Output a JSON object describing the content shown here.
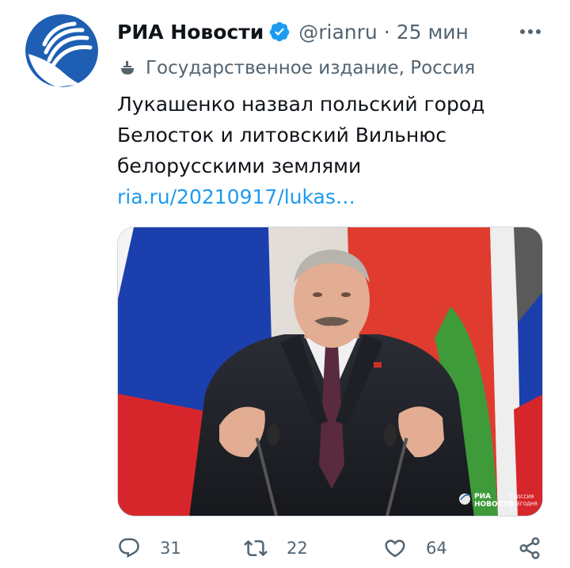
{
  "author": {
    "display_name": "РИА Новости",
    "handle": "@rianru",
    "separator": "·",
    "time": "25 мин"
  },
  "label": {
    "text": "Государственное издание, Россия",
    "icon": "state-media-icon"
  },
  "tweet": {
    "lines": [
      "Лукашенко назвал польский город",
      "Белосток и литовский Вильнюс",
      "белорусскими землями"
    ],
    "link": "ria.ru/20210917/lukas…"
  },
  "media": {
    "watermark_line1": "РИА",
    "watermark_line2": "НОВОСТИ",
    "watermark_badge_line1": "РОССИЯ",
    "watermark_badge_line2": "СЕГОДНЯ"
  },
  "actions": {
    "reply_count": "31",
    "retweet_count": "22",
    "like_count": "64"
  },
  "colors": {
    "accent": "#1d9bf0",
    "secondary_text": "#536471",
    "primary_text": "#0f1419",
    "avatar_blue": "#1e5fb3"
  }
}
